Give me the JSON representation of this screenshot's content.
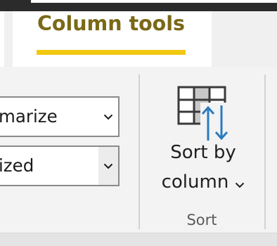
{
  "tab": {
    "label": "Column tools",
    "underline_color": "#f2c811",
    "text_color": "#7a6817"
  },
  "properties": {
    "summarization_value": "marize",
    "data_category_value": "ized"
  },
  "sort": {
    "button_line1": "Sort by",
    "button_line2": "column",
    "group_label": "Sort",
    "icon": "sort-by-column-icon"
  }
}
